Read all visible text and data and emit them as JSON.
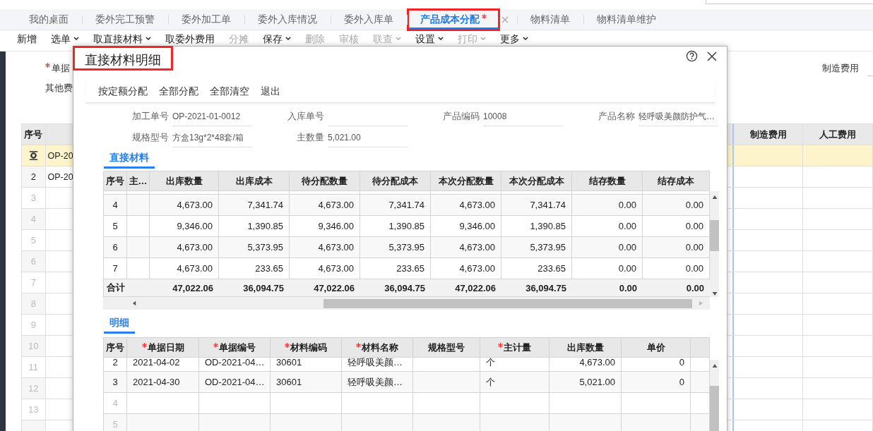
{
  "tabs": [
    {
      "label": "我的桌面",
      "selected": false,
      "highlighted": false,
      "unsaved": false
    },
    {
      "label": "委外完工预警",
      "selected": false,
      "highlighted": false,
      "unsaved": false
    },
    {
      "label": "委外加工单",
      "selected": false,
      "highlighted": false,
      "unsaved": false
    },
    {
      "label": "委外入库情况",
      "selected": false,
      "highlighted": false,
      "unsaved": false
    },
    {
      "label": "委外入库单",
      "selected": false,
      "highlighted": false,
      "unsaved": false
    },
    {
      "label": "产品成本分配",
      "selected": true,
      "highlighted": true,
      "unsaved": true
    },
    {
      "label": "物料清单",
      "selected": false,
      "highlighted": false,
      "unsaved": false
    },
    {
      "label": "物料清单维护",
      "selected": false,
      "highlighted": false,
      "unsaved": false
    }
  ],
  "toolbar": [
    {
      "label": "新增",
      "disabled": false,
      "dropdown": false
    },
    {
      "label": "选单",
      "disabled": false,
      "dropdown": true
    },
    {
      "label": "取直接材料",
      "disabled": false,
      "dropdown": true
    },
    {
      "label": "取委外费用",
      "disabled": false,
      "dropdown": false
    },
    {
      "label": "分摊",
      "disabled": true,
      "dropdown": false
    },
    {
      "label": "保存",
      "disabled": false,
      "dropdown": true
    },
    {
      "label": "删除",
      "disabled": true,
      "dropdown": false
    },
    {
      "label": "审核",
      "disabled": true,
      "dropdown": false
    },
    {
      "label": "联查",
      "disabled": true,
      "dropdown": true
    },
    {
      "label": "设置",
      "disabled": false,
      "dropdown": true
    },
    {
      "label": "打印",
      "disabled": true,
      "dropdown": true
    },
    {
      "label": "更多",
      "disabled": false,
      "dropdown": true
    }
  ],
  "form": {
    "left": [
      {
        "label": "单据",
        "required": true
      },
      {
        "label": "其他费",
        "required": false
      }
    ],
    "right": [
      {
        "label": "制造费用",
        "required": false
      }
    ]
  },
  "grid": {
    "columns": [
      "序号",
      "制造费用",
      "人工费用"
    ],
    "rows": [
      {
        "code": "OP-20",
        "selected": true
      },
      {
        "number": "2",
        "code": "OP-20",
        "selected": false
      },
      {
        "number": "3",
        "selected": false
      },
      {
        "number": "4",
        "selected": false
      },
      {
        "number": "5",
        "selected": false
      },
      {
        "number": "6",
        "selected": false
      },
      {
        "number": "7",
        "selected": false
      },
      {
        "number": "8",
        "selected": false
      },
      {
        "number": "9",
        "selected": false
      },
      {
        "number": "10",
        "selected": false
      },
      {
        "number": "11",
        "selected": false
      },
      {
        "number": "12",
        "selected": false
      },
      {
        "number": "13",
        "selected": false
      },
      {
        "selected": false
      }
    ]
  },
  "dialog": {
    "title": "直接材料明细",
    "title_highlighted": true,
    "actions": [
      "按定额分配",
      "全部分配",
      "全部清空",
      "退出"
    ],
    "fields": [
      {
        "label": "加工单号",
        "value": "OP-2021-01-0012"
      },
      {
        "label": "入库单号"
      },
      {
        "label": "产品编码",
        "value": "10008"
      },
      {
        "label": "产品名称",
        "value": "轻呼吸美颜防护气…"
      },
      {
        "label": "规格型号",
        "value": "方盒13g*2*48套/箱"
      },
      {
        "label": "主数量",
        "value": "5,021.00"
      }
    ],
    "materials": {
      "tab": {
        "label": "直接材料",
        "selected": true
      },
      "columns": [
        "序号",
        "主…",
        "出库数量",
        "出库成本",
        "待分配数量",
        "待分配成本",
        "本次分配数量",
        "本次分配成本",
        "结存数量",
        "结存成本"
      ],
      "rows": [
        {
          "cells": [
            "4",
            "",
            "4,673.00",
            "7,341.74",
            "4,673.00",
            "7,341.74",
            "4,673.00",
            "7,341.74",
            "0.00",
            "0.00"
          ]
        },
        {
          "cells": [
            "5",
            "",
            "9,346.00",
            "1,390.85",
            "9,346.00",
            "1,390.85",
            "9,346.00",
            "1,390.85",
            "0.00",
            "0.00"
          ]
        },
        {
          "cells": [
            "6",
            "",
            "4,673.00",
            "5,373.95",
            "4,673.00",
            "5,373.95",
            "4,673.00",
            "5,373.95",
            "0.00",
            "0.00"
          ]
        },
        {
          "cells": [
            "7",
            "",
            "4,673.00",
            "233.65",
            "4,673.00",
            "233.65",
            "4,673.00",
            "233.65",
            "0.00",
            "0.00"
          ]
        }
      ],
      "totals": {
        "label": "合计",
        "values": [
          "47,022.06",
          "36,094.75",
          "47,022.06",
          "36,094.75",
          "47,022.06",
          "36,094.75",
          "0.00",
          "0.00"
        ]
      }
    },
    "details": {
      "tab": {
        "label": "明细",
        "selected": true
      },
      "columns": [
        {
          "label": "序号",
          "required": false
        },
        {
          "label": "单据日期",
          "required": true
        },
        {
          "label": "单据编号",
          "required": true
        },
        {
          "label": "材料编码",
          "required": true
        },
        {
          "label": "材料名称",
          "required": true
        },
        {
          "label": "规格型号",
          "required": false
        },
        {
          "label": "主计量",
          "required": true
        },
        {
          "label": "出库数量",
          "required": false
        },
        {
          "label": "单价",
          "required": false
        }
      ],
      "rows": [
        {
          "number": "2",
          "cells": [
            "2021-04-02",
            "OD-2021-04…",
            "30601",
            "轻呼吸美颜…",
            null,
            "个",
            "4,673.00",
            "0"
          ]
        },
        {
          "number": "3",
          "cells": [
            "2021-04-30",
            "OD-2021-04…",
            "30601",
            "轻呼吸美颜…",
            null,
            "个",
            "5,021.00",
            "0"
          ]
        },
        {
          "number": "4"
        },
        {
          "number": "5"
        }
      ]
    }
  }
}
